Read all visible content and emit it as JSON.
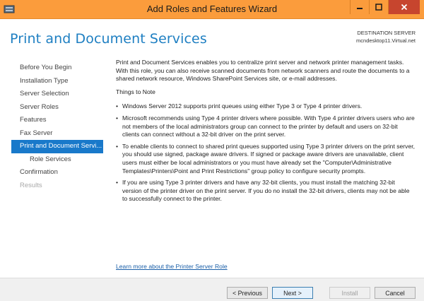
{
  "window": {
    "title": "Add Roles and Features Wizard"
  },
  "page": {
    "title": "Print and Document Services",
    "destination_label": "DESTINATION SERVER",
    "destination_server": "mcndesktop11.Virtual.net"
  },
  "nav": {
    "items": [
      {
        "label": "Before You Begin"
      },
      {
        "label": "Installation Type"
      },
      {
        "label": "Server Selection"
      },
      {
        "label": "Server Roles"
      },
      {
        "label": "Features"
      },
      {
        "label": "Fax Server"
      },
      {
        "label": "Print and Document Servi..."
      },
      {
        "label": "Role Services"
      },
      {
        "label": "Confirmation"
      },
      {
        "label": "Results"
      }
    ]
  },
  "content": {
    "intro": "Print and Document Services enables you to centralize print server and network printer management tasks. With this role, you can also receive scanned documents from network scanners and route the documents to a shared network resource, Windows SharePoint Services site, or e-mail addresses.",
    "notes_heading": "Things to Note",
    "bullets": [
      "Windows Server 2012 supports print queues using either Type 3 or Type 4 printer drivers.",
      "Microsoft recommends using Type 4 printer drivers where possible. With Type 4 printer drivers users who are not members of the local administrators group can connect to the printer by default and users on 32-bit clients can connect without a 32-bit driver on the print server.",
      "To enable clients to connect to shared print queues supported using Type 3 printer drivers on the print server, you should use signed, package aware drivers. If signed or package aware drivers are unavailable, client users must either be local administrators or you must have already set the \"Computer\\Administrative Templates\\Printers\\Point and Print Restrictions\" group policy to configure security prompts.",
      "If you are using Type 3 printer drivers and have any 32-bit clients, you must install the matching 32-bit version of the printer driver on the print server. If you do no install the 32-bit drivers, clients may not be able to successfully connect to the printer."
    ],
    "learn_more": "Learn more about the Printer Server Role"
  },
  "footer": {
    "previous": "< Previous",
    "next": "Next >",
    "install": "Install",
    "cancel": "Cancel"
  },
  "colors": {
    "titlebar": "#fb9c3c",
    "accent": "#1979ca",
    "title_text": "#1e7fc2",
    "close_button": "#c7452e"
  }
}
